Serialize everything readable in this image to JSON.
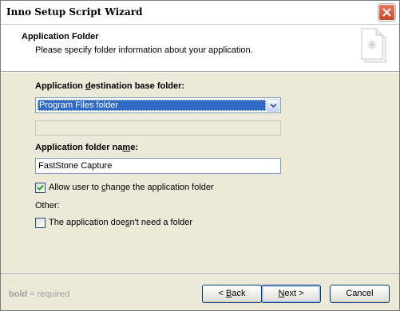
{
  "window": {
    "title": "Inno Setup Script Wizard"
  },
  "header": {
    "title": "Application Folder",
    "subtitle": "Please specify folder information about your application."
  },
  "form": {
    "dest_label": {
      "pre": "Application ",
      "u": "d",
      "post": "estination base folder:"
    },
    "dest_select_value": "Program Files folder",
    "custom_folder_value": "",
    "name_label": {
      "pre": "Application folder na",
      "u": "m",
      "post": "e:"
    },
    "name_value": "FastStone Capture",
    "allow_change": {
      "checked": true,
      "pre": "Allow user to ",
      "u": "c",
      "post": "hange the application folder"
    },
    "other_label": "Other:",
    "no_folder": {
      "checked": false,
      "pre": "The application doe",
      "u": "s",
      "post": "n't need a folder"
    }
  },
  "footer": {
    "note_bold": "bold",
    "note_rest": " = required",
    "back": {
      "u": "B",
      "post": "ack",
      "prefix": "< "
    },
    "next": {
      "pre": "",
      "u": "N",
      "post": "ext >"
    },
    "cancel": "Cancel"
  },
  "colors": {
    "selection": "#316ac5",
    "window_bg": "#ece9d8",
    "close_button": "#d5583b"
  },
  "icons": {
    "close": "close-icon",
    "wizard": "wizard-document-icon",
    "dropdown": "chevron-down-icon",
    "check": "checkmark-icon"
  }
}
